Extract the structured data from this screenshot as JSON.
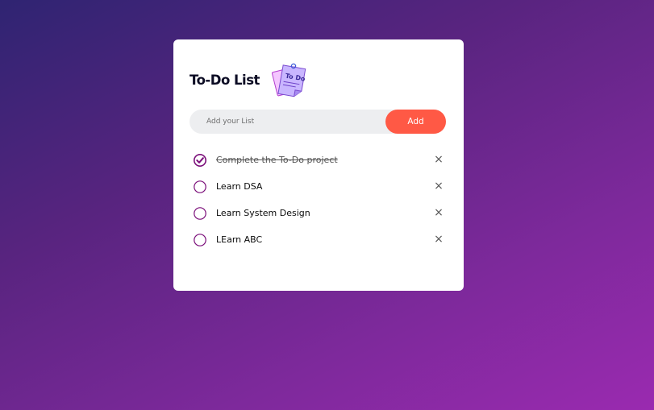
{
  "app": {
    "title": "To-Do List",
    "logo_icon": "todo-sticky-note-icon",
    "logo_text": "To Do"
  },
  "input": {
    "placeholder": "Add your List",
    "value": ""
  },
  "add_button": {
    "label": "Add"
  },
  "colors": {
    "accent": "#ff5945",
    "check": "#7b0f7a",
    "background_start": "#2f2472",
    "background_end": "#9a2ab0"
  },
  "tasks": [
    {
      "text": "Complete the To-Do project",
      "checked": true,
      "close_label": "×"
    },
    {
      "text": "Learn DSA",
      "checked": false,
      "close_label": "×"
    },
    {
      "text": "Learn System Design",
      "checked": false,
      "close_label": "×"
    },
    {
      "text": "LEarn ABC",
      "checked": false,
      "close_label": "×"
    }
  ]
}
